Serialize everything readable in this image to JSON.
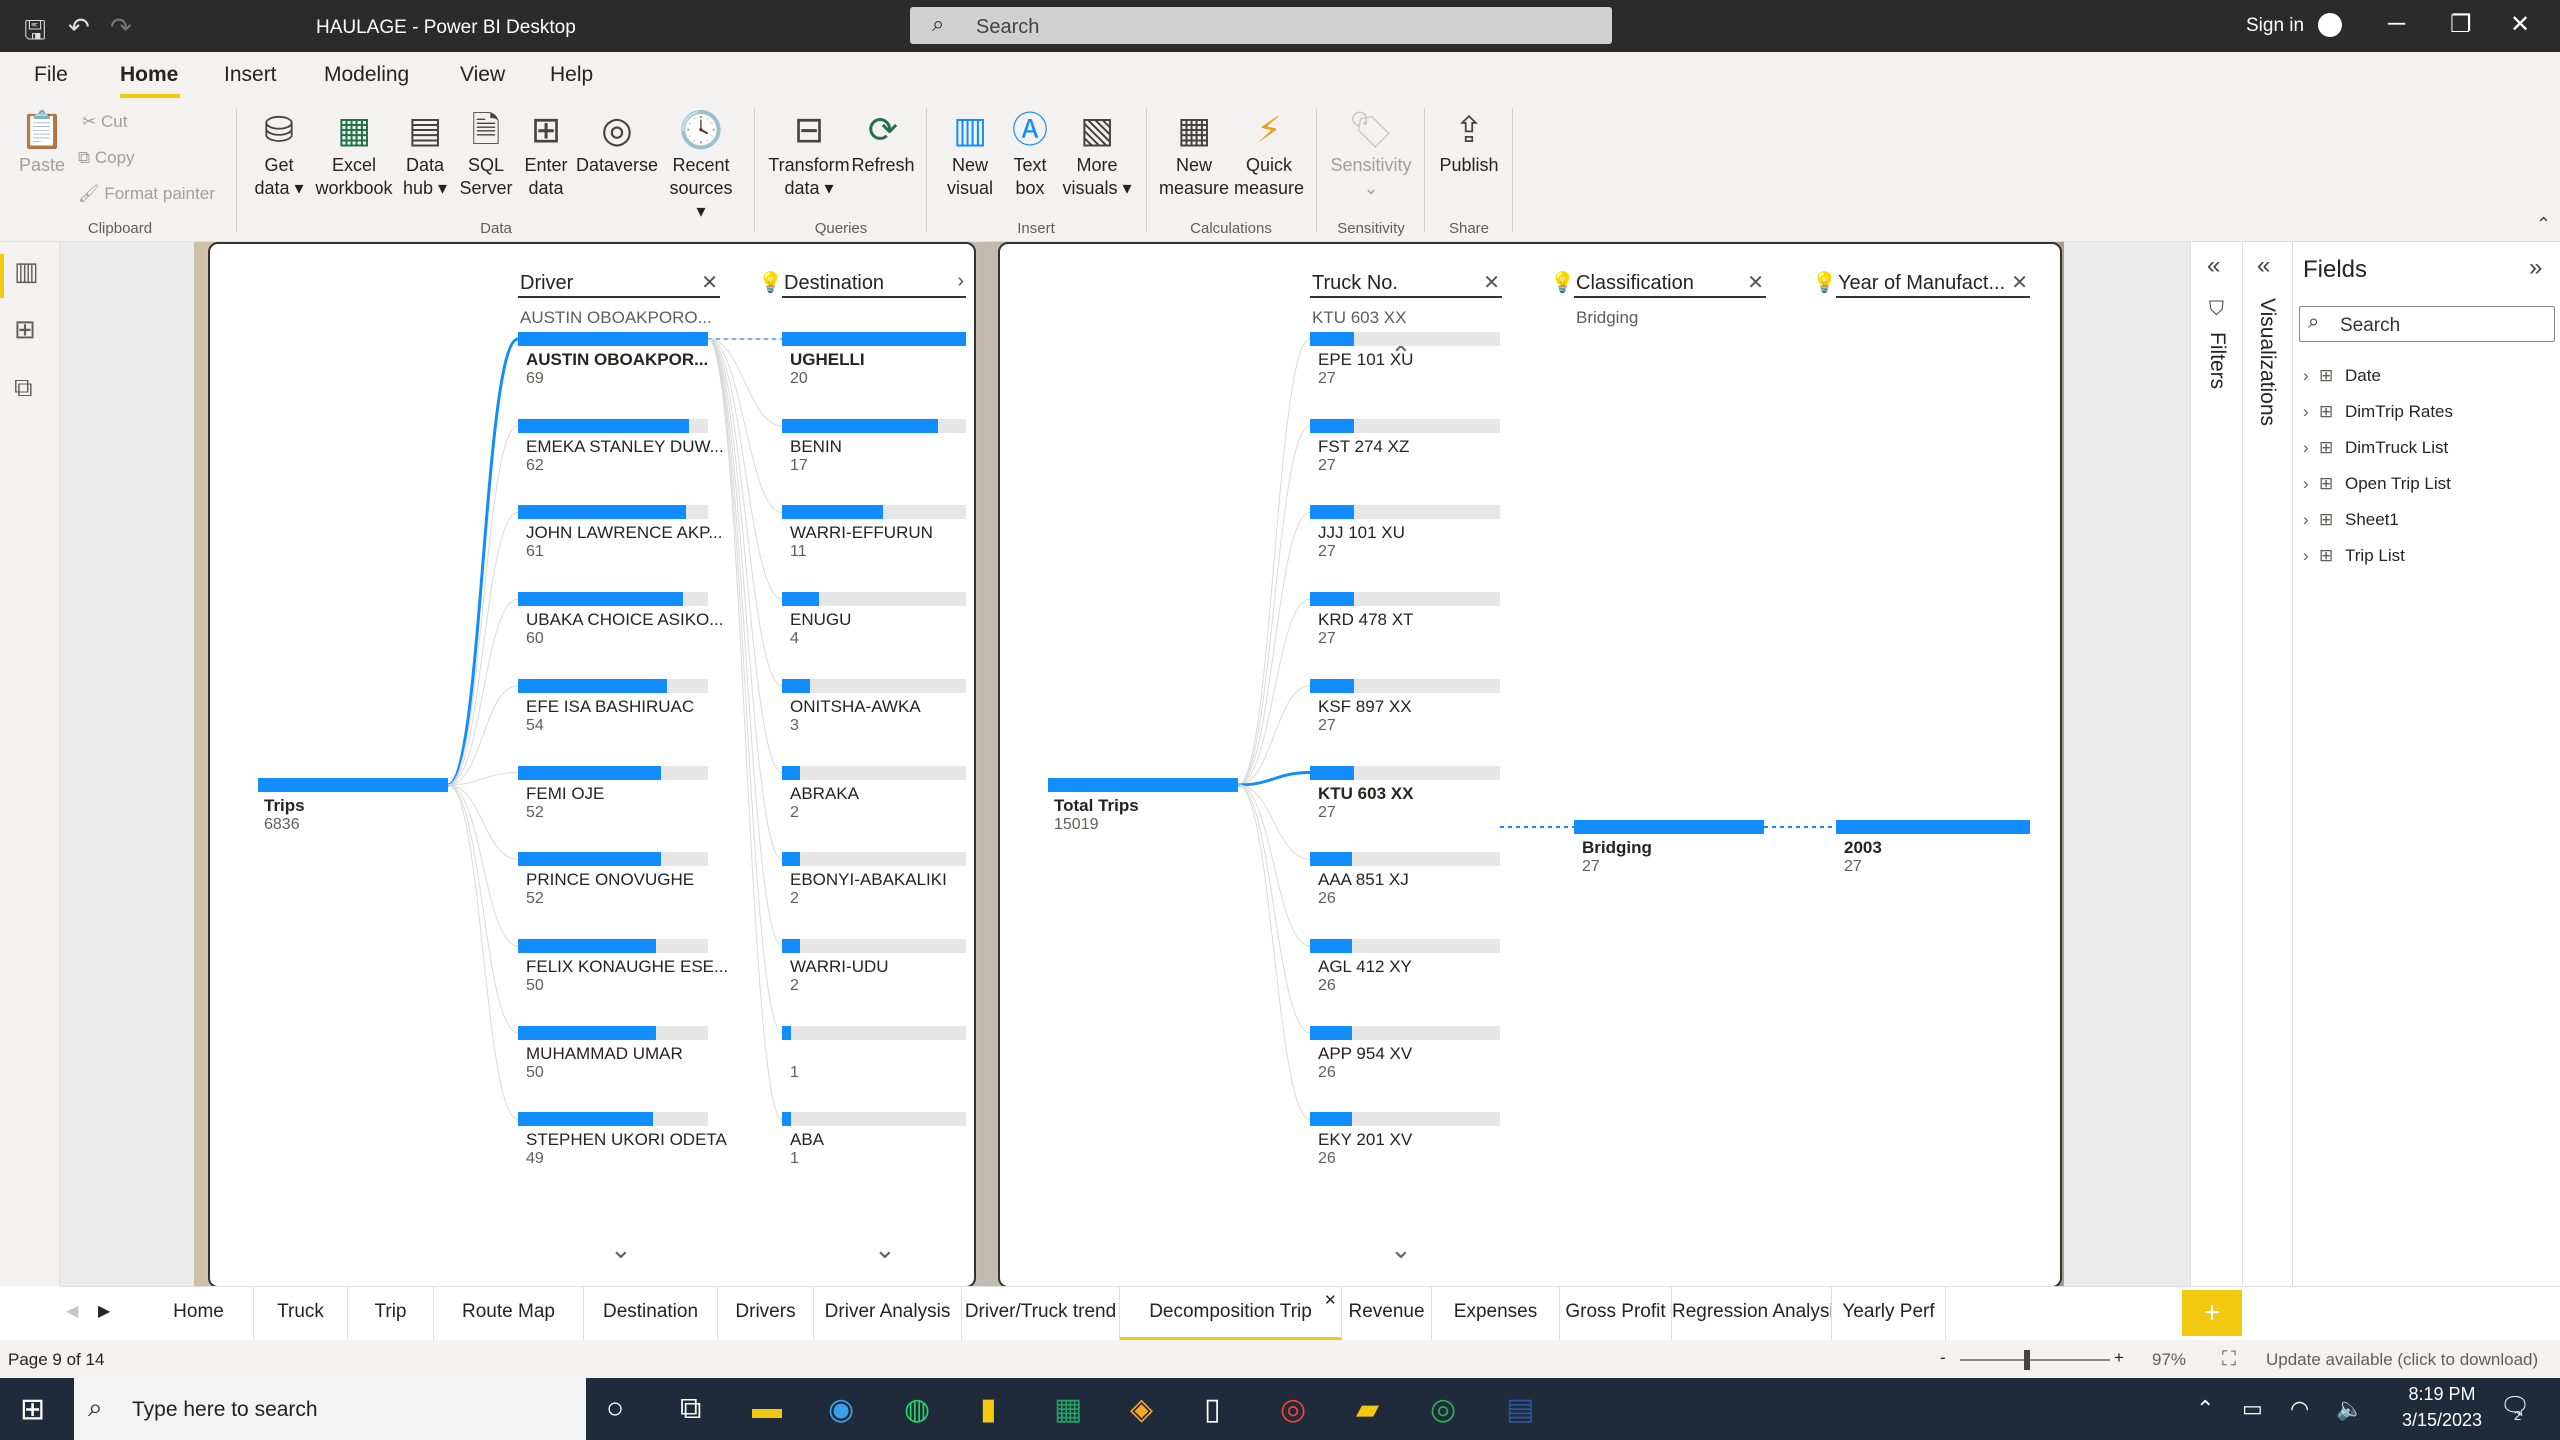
{
  "titlebar": {
    "title": "HAULAGE - Power BI Desktop",
    "search_placeholder": "Search",
    "sign_in": "Sign in",
    "icons": [
      "save-icon",
      "undo-icon",
      "redo-icon",
      "search-icon",
      "minimize-icon",
      "restore-icon",
      "close-icon"
    ]
  },
  "menu": {
    "items": [
      "File",
      "Home",
      "Insert",
      "Modeling",
      "View",
      "Help"
    ],
    "active": "Home"
  },
  "ribbon": {
    "paste": "Paste",
    "cut": "Cut",
    "copy": "Copy",
    "format_painter": "Format painter",
    "get_data": [
      "Get",
      "data ▾"
    ],
    "excel": [
      "Excel",
      "workbook"
    ],
    "data_hub": [
      "Data",
      "hub ▾"
    ],
    "sql": [
      "SQL",
      "Server"
    ],
    "enter_data": [
      "Enter",
      "data"
    ],
    "dataverse": "Dataverse",
    "recent_sources": [
      "Recent",
      "sources ▾"
    ],
    "transform": [
      "Transform",
      "data ▾"
    ],
    "refresh": "Refresh",
    "new_visual": [
      "New",
      "visual"
    ],
    "text_box": [
      "Text",
      "box"
    ],
    "more_visuals": [
      "More",
      "visuals ▾"
    ],
    "new_measure": [
      "New",
      "measure"
    ],
    "quick_measure": [
      "Quick",
      "measure"
    ],
    "sensitivity": "Sensitivity",
    "publish": "Publish",
    "groups": {
      "clipboard": "Clipboard",
      "data": "Data",
      "queries": "Queries",
      "insert": "Insert",
      "calculations": "Calculations",
      "sensitivity": "Sensitivity",
      "share": "Share"
    }
  },
  "tree1": {
    "root": {
      "label": "Trips",
      "value": "6836"
    },
    "driver": {
      "header": "Driver",
      "selected": "AUSTIN OBOAKPORO...",
      "nodes": [
        {
          "label": "AUSTIN OBOAKPOR...",
          "value": "69",
          "fraction": 1.0
        },
        {
          "label": "EMEKA STANLEY DUW...",
          "value": "62",
          "fraction": 0.899
        },
        {
          "label": "JOHN LAWRENCE AKP...",
          "value": "61",
          "fraction": 0.884
        },
        {
          "label": "UBAKA CHOICE ASIKO...",
          "value": "60",
          "fraction": 0.87
        },
        {
          "label": "EFE ISA BASHIRUAC",
          "value": "54",
          "fraction": 0.783
        },
        {
          "label": "FEMI OJE",
          "value": "52",
          "fraction": 0.754
        },
        {
          "label": "PRINCE ONOVUGHE",
          "value": "52",
          "fraction": 0.754
        },
        {
          "label": "FELIX KONAUGHE ESE...",
          "value": "50",
          "fraction": 0.725
        },
        {
          "label": "MUHAMMAD UMAR",
          "value": "50",
          "fraction": 0.725
        },
        {
          "label": "STEPHEN UKORI ODETA",
          "value": "49",
          "fraction": 0.71
        }
      ]
    },
    "destination": {
      "header": "Destination",
      "nodes": [
        {
          "label": "UGHELLI",
          "value": "20",
          "fraction": 1.0
        },
        {
          "label": "BENIN",
          "value": "17",
          "fraction": 0.85
        },
        {
          "label": "WARRI-EFFURUN",
          "value": "11",
          "fraction": 0.55
        },
        {
          "label": "ENUGU",
          "value": "4",
          "fraction": 0.2
        },
        {
          "label": "ONITSHA-AWKA",
          "value": "3",
          "fraction": 0.15
        },
        {
          "label": "ABRAKA",
          "value": "2",
          "fraction": 0.1
        },
        {
          "label": "EBONYI-ABAKALIKI",
          "value": "2",
          "fraction": 0.1
        },
        {
          "label": "WARRI-UDU",
          "value": "2",
          "fraction": 0.1
        },
        {
          "label": "",
          "value": "1",
          "fraction": 0.05
        },
        {
          "label": "ABA",
          "value": "1",
          "fraction": 0.05
        }
      ]
    }
  },
  "tree2": {
    "root": {
      "label": "Total Trips",
      "value": "15019"
    },
    "truck": {
      "header": "Truck No.",
      "selected": "KTU 603 XX",
      "nodes": [
        {
          "label": "EPE 101 XU",
          "value": "27",
          "fraction": 0.23
        },
        {
          "label": "FST 274 XZ",
          "value": "27",
          "fraction": 0.23
        },
        {
          "label": "JJJ 101 XU",
          "value": "27",
          "fraction": 0.23
        },
        {
          "label": "KRD 478 XT",
          "value": "27",
          "fraction": 0.23
        },
        {
          "label": "KSF 897 XX",
          "value": "27",
          "fraction": 0.23
        },
        {
          "label": "KTU 603 XX",
          "value": "27",
          "fraction": 0.23
        },
        {
          "label": "AAA 851 XJ",
          "value": "26",
          "fraction": 0.22
        },
        {
          "label": "AGL 412 XY",
          "value": "26",
          "fraction": 0.22
        },
        {
          "label": "APP 954 XV",
          "value": "26",
          "fraction": 0.22
        },
        {
          "label": "EKY 201 XV",
          "value": "26",
          "fraction": 0.22
        }
      ]
    },
    "classification": {
      "header": "Classification",
      "selected": "Bridging",
      "node": {
        "label": "Bridging",
        "value": "27",
        "fraction": 1.0
      }
    },
    "year": {
      "header": "Year of Manufact...",
      "node": {
        "label": "2003",
        "value": "27",
        "fraction": 1.0
      }
    }
  },
  "panes": {
    "filters": "Filters",
    "visualizations": "Visualizations",
    "fields_title": "Fields",
    "fields_search": "Search",
    "fields": [
      "Date",
      "DimTrip Rates",
      "DimTruck List",
      "Open Trip List",
      "Sheet1",
      "Trip List"
    ]
  },
  "tabs": {
    "items": [
      "Home",
      "Truck",
      "Trip",
      "Route Map",
      "Destination",
      "Drivers",
      "Driver Analysis",
      "Driver/Truck trend",
      "Decomposition Trip",
      "Revenue",
      "Expenses",
      "Gross Profit",
      "Regression Analysis",
      "Yearly Perf"
    ],
    "active": "Decomposition Trip",
    "add": "+"
  },
  "status": {
    "page": "Page 9 of 14",
    "zoom": "97%",
    "zoom_minus": "-",
    "zoom_plus": "+",
    "update": "Update available (click to download)"
  },
  "taskbar": {
    "search_placeholder": "Type here to search",
    "time": "8:19 PM",
    "date": "3/15/2023",
    "notifications": "2"
  }
}
